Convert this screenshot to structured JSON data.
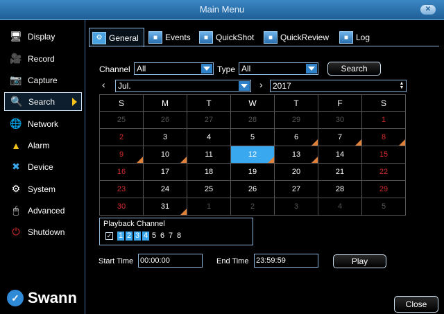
{
  "title": "Main Menu",
  "sidebar": {
    "items": [
      {
        "label": "Display",
        "icon": "monitor-icon"
      },
      {
        "label": "Record",
        "icon": "camera-record-icon"
      },
      {
        "label": "Capture",
        "icon": "capture-icon"
      },
      {
        "label": "Search",
        "icon": "search-icon"
      },
      {
        "label": "Network",
        "icon": "globe-icon"
      },
      {
        "label": "Alarm",
        "icon": "warning-icon"
      },
      {
        "label": "Device",
        "icon": "tools-icon"
      },
      {
        "label": "System",
        "icon": "gear-icon"
      },
      {
        "label": "Advanced",
        "icon": "mouse-icon"
      },
      {
        "label": "Shutdown",
        "icon": "power-icon"
      }
    ],
    "active_index": 3,
    "logo_text": "Swann"
  },
  "tabs": [
    {
      "label": "General"
    },
    {
      "label": "Events"
    },
    {
      "label": "QuickShot"
    },
    {
      "label": "QuickReview"
    },
    {
      "label": "Log"
    }
  ],
  "filters": {
    "channel_label": "Channel",
    "channel_value": "All",
    "type_label": "Type",
    "type_value": "All",
    "search_label": "Search",
    "month_value": "Jul.",
    "year_value": "2017"
  },
  "calendar": {
    "weekdays": [
      "S",
      "M",
      "T",
      "W",
      "T",
      "F",
      "S"
    ],
    "rows": [
      [
        "25",
        "26",
        "27",
        "28",
        "29",
        "30",
        "1"
      ],
      [
        "2",
        "3",
        "4",
        "5",
        "6",
        "7",
        "8"
      ],
      [
        "9",
        "10",
        "11",
        "12",
        "13",
        "14",
        "15"
      ],
      [
        "16",
        "17",
        "18",
        "19",
        "20",
        "21",
        "22"
      ],
      [
        "23",
        "24",
        "25",
        "26",
        "27",
        "28",
        "29"
      ],
      [
        "30",
        "31",
        "1",
        "2",
        "3",
        "4",
        "5"
      ]
    ],
    "selected_day": "12"
  },
  "playback": {
    "title": "Playback Channel",
    "checked_mark": "✓",
    "channels": [
      "1",
      "2",
      "3",
      "4",
      "5",
      "6",
      "7",
      "8"
    ]
  },
  "time": {
    "start_label": "Start Time",
    "start_value": "00:00:00",
    "end_label": "End Time",
    "end_value": "23:59:59",
    "play_label": "Play"
  },
  "close_label": "Close",
  "colors": {
    "accent": "#3aa8ef",
    "weekend": "#d42b2b",
    "record_marker": "#e0813a",
    "title_bar": "#2c72b0"
  }
}
